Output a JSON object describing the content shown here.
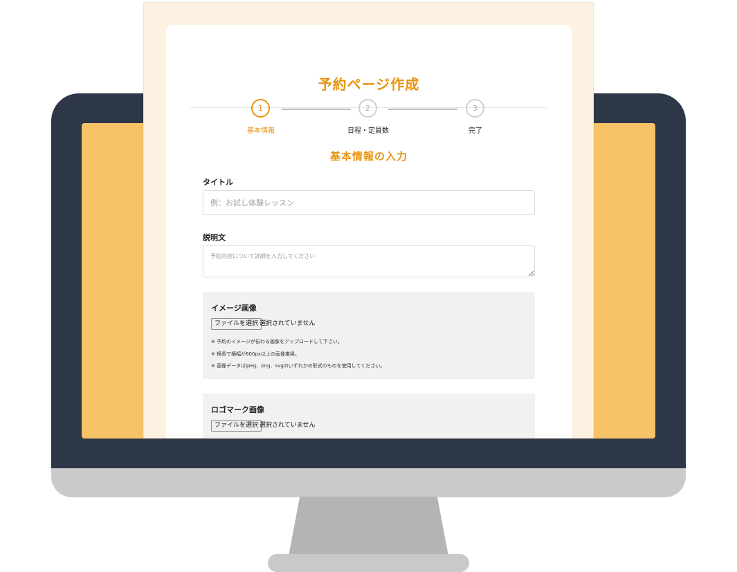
{
  "page": {
    "title": "予約ページ作成",
    "steps": [
      {
        "number": "1",
        "label": "基本情報",
        "active": true
      },
      {
        "number": "2",
        "label": "日程・定員数",
        "active": false
      },
      {
        "number": "3",
        "label": "完了",
        "active": false
      }
    ],
    "section_title": "基本情報の入力",
    "fields": {
      "title_label": "タイトル",
      "title_placeholder": "例：お試し体験レッスン",
      "description_label": "説明文",
      "description_placeholder": "予約内容について詳細を入力してください"
    },
    "image_upload": {
      "label": "イメージ画像",
      "button_label": "ファイルを選択",
      "status": "選択されていません",
      "notes": [
        "※ 予約のイメージが伝わる画像をアップロードして下さい。",
        "※ 横長で横幅が600px以上の画像推奨。",
        "※ 画像データはjpeg、png、svgのいずれかの形式のものを使用してください。"
      ]
    },
    "logo_upload": {
      "label": "ロゴマーク画像",
      "button_label": "ファイルを選択",
      "status": "選択されていません"
    }
  },
  "colors": {
    "accent": "#e8930f",
    "monitor_frame": "#2d3748",
    "monitor_screen": "#f7c268",
    "page_background": "#fdf2e2"
  }
}
